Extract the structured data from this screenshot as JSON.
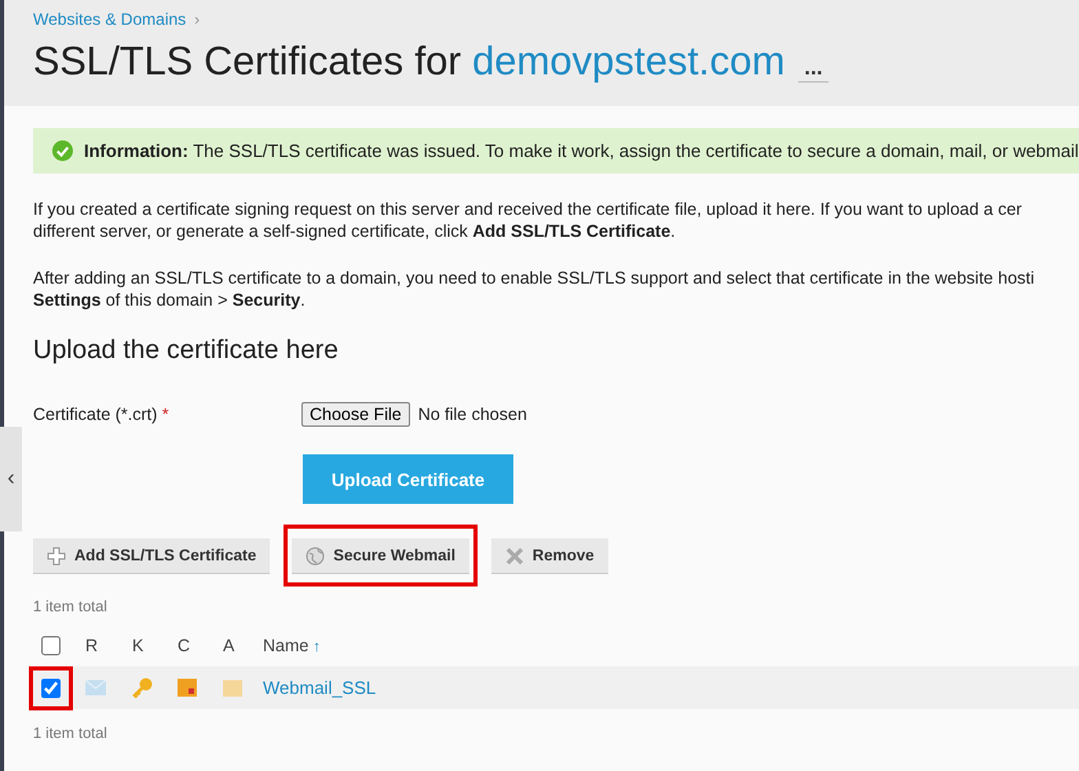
{
  "breadcrumb": [
    {
      "label": "Websites & Domains",
      "separator": "›"
    }
  ],
  "title": {
    "prefix": "SSL/TLS Certificates for",
    "domain": "demovpstest.com",
    "more": "..."
  },
  "notice": {
    "kind": "success",
    "label": "Information:",
    "text": "The SSL/TLS certificate was issued. To make it work, assign the certificate to secure a domain, mail, or webmail"
  },
  "paragraphs": [
    [
      "If you created a certificate signing request on this server and received the certificate file, upload it here. If you want to upload a cer",
      "different server, or generate a self-signed certificate, click **Add SSL/TLS Certificate**."
    ],
    [
      "After adding an SSL/TLS certificate to a domain, you need to enable SSL/TLS support and select that certificate in the website hosti",
      "**Settings** of this domain > **Security**."
    ]
  ],
  "upload": {
    "heading": "Upload the certificate here",
    "field_label": "Certificate (*.crt)",
    "required_mark": "*",
    "file_button": "Choose File",
    "file_status": "No file chosen",
    "submit": "Upload Certificate"
  },
  "toolbar": [
    {
      "kind": "add",
      "label": "Add SSL/TLS Certificate",
      "highlighted": false
    },
    {
      "kind": "webmail",
      "label": "Secure Webmail",
      "highlighted": true
    },
    {
      "kind": "remove",
      "label": "Remove",
      "highlighted": false
    }
  ],
  "total_top": "1 item total",
  "table": {
    "columns": [
      "R",
      "K",
      "C",
      "A",
      "Name"
    ],
    "sort_mark": "↑",
    "all_checked": false,
    "rows": [
      {
        "checked": true,
        "highlighted": true,
        "name": "Webmail_SSL"
      }
    ]
  },
  "total_bottom": "1 item total",
  "side_handle": "‹"
}
